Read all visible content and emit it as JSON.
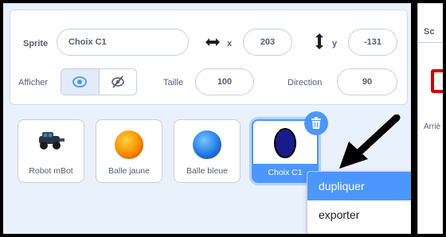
{
  "sprite_info": {
    "sprite_label": "Sprite",
    "sprite_name": "Choix C1",
    "x_label": "x",
    "x_value": "203",
    "y_label": "y",
    "y_value": "-131",
    "show_label": "Afficher",
    "size_label": "Taille",
    "size_value": "100",
    "direction_label": "Direction",
    "direction_value": "90"
  },
  "sprites": [
    {
      "name": "Robot mBot",
      "icon": "robot-mbot-icon"
    },
    {
      "name": "Balle jaune",
      "icon": "orange-ball-icon"
    },
    {
      "name": "Balle bleue",
      "icon": "blue-ball-icon"
    },
    {
      "name": "Choix C1",
      "icon": "dark-blue-ellipse-icon",
      "selected": true
    }
  ],
  "context_menu": {
    "items": [
      "dupliquer",
      "exporter"
    ]
  },
  "stage_panel": {
    "tab_label": "Sc",
    "backdrop_label": "Arriè"
  },
  "colors": {
    "accent": "#4c97ff",
    "panel_bg": "#e9f1fc",
    "text": "#575e75"
  }
}
